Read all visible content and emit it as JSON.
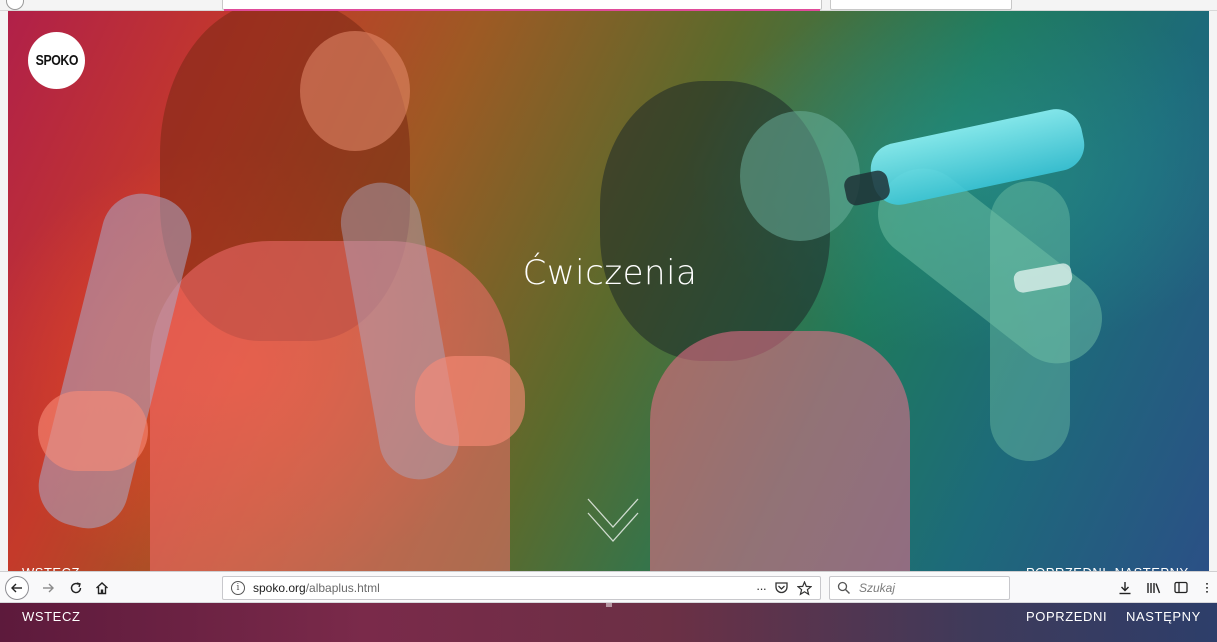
{
  "site": {
    "logo_text": "SPOKO",
    "hero_title": "Ćwiczenia",
    "nav_back": "WSTECZ",
    "nav_prev": "POPRZEDNI",
    "nav_next": "NASTĘPNY"
  },
  "browser": {
    "url_domain": "spoko.org",
    "url_path": "/albaplus.html",
    "search_placeholder": "Szukaj",
    "menu_label": "···"
  },
  "colors": {
    "accent_pink": "#e04b9a",
    "toolbar_bg": "#f9f9fa"
  },
  "icons": [
    "back-arrow-icon",
    "forward-arrow-icon",
    "reload-icon",
    "home-icon",
    "info-icon",
    "pocket-icon",
    "bookmark-star-icon",
    "search-icon",
    "download-icon",
    "library-icon",
    "sidebar-icon",
    "menu-icon",
    "chevron-down-icon"
  ]
}
